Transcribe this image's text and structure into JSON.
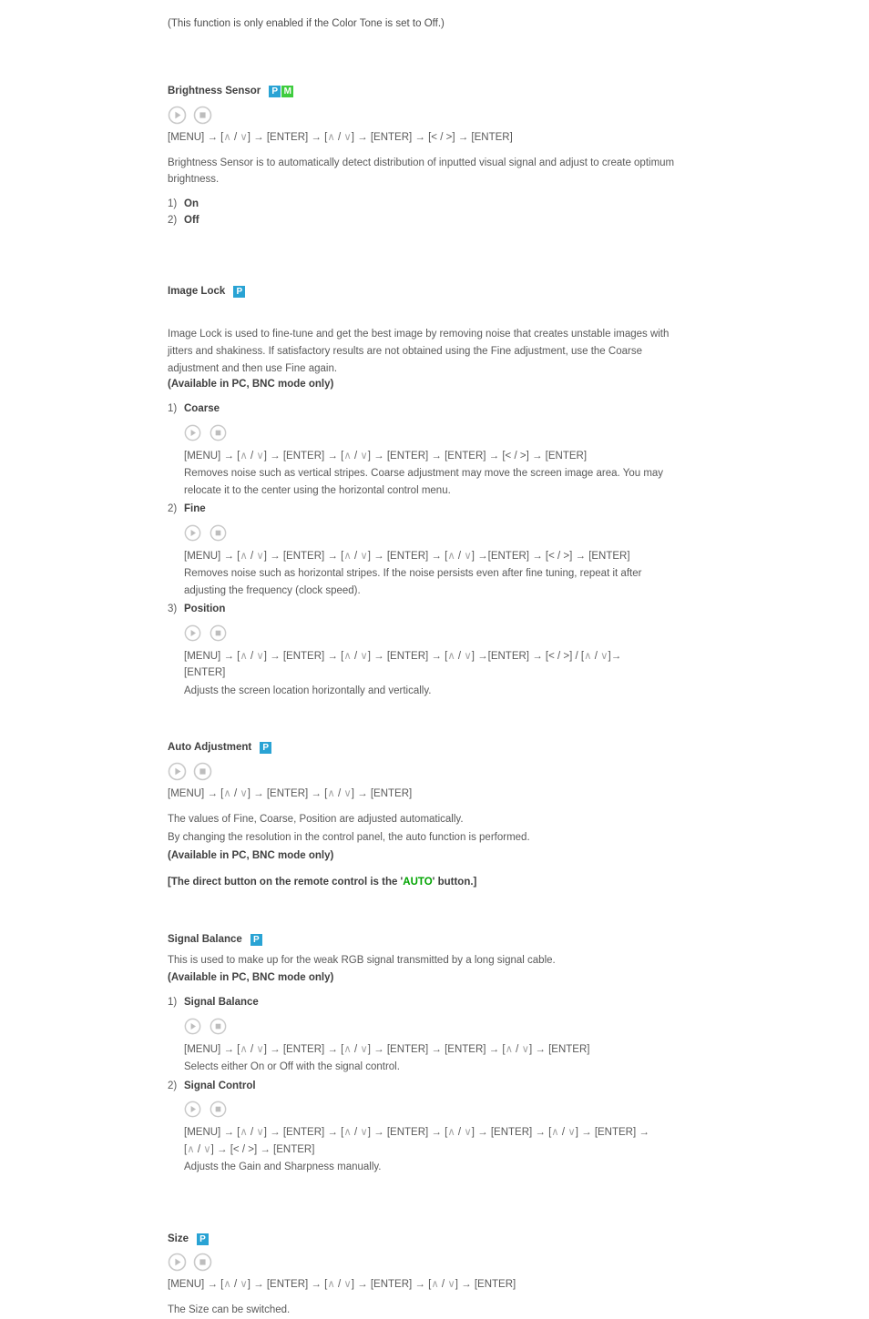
{
  "page": {
    "intro_note": "(This function is only enabled if the Color Tone is set to Off.)"
  },
  "colors": {
    "badge_p": "#29a3d4",
    "badge_m": "#3ecc3e",
    "auto_green": "#00a400",
    "text": "#595959",
    "heading": "#3f3f3f",
    "dim_arrow_key": "#a6a6a6"
  },
  "icons": {
    "play": "play-circle-icon",
    "stop": "stop-circle-icon",
    "badge_p": "pc-mode-badge-icon",
    "badge_m": "media-mode-badge-icon"
  },
  "badges": {
    "p_label": "P",
    "m_label": "M"
  },
  "sections": [
    {
      "id": "brightness-sensor",
      "title": "Brightness Sensor",
      "badges": [
        "P",
        "M"
      ],
      "menu_path": "[MENU] → [∧ / ∨] → [ENTER] → [∧ / ∨] → [ENTER] → [< / >] → [ENTER]",
      "description": "Brightness Sensor is to automatically detect distribution of inputted visual signal and adjust to create optimum brightness.",
      "items": [
        {
          "num": "1)",
          "label": "On"
        },
        {
          "num": "2)",
          "label": "Off"
        }
      ]
    },
    {
      "id": "image-lock",
      "title": "Image Lock",
      "badges": [
        "P"
      ],
      "description": "Image Lock is used to fine-tune and get the best image by removing noise that creates unstable images with jitters and shakiness. If satisfactory results are not obtained using the Fine adjustment, use the Coarse adjustment and then use Fine again.",
      "availability": "(Available in PC, BNC mode only)",
      "sub_items": [
        {
          "num": "1)",
          "label": "Coarse",
          "menu_path": "[MENU] → [∧ / ∨] → [ENTER] → [∧ / ∨] → [ENTER] → [ENTER] → [< / >] → [ENTER]",
          "description": "Removes noise such as vertical stripes. Coarse adjustment may move the screen image area. You may relocate it to the center using the horizontal control menu."
        },
        {
          "num": "2)",
          "label": "Fine",
          "menu_path": "[MENU] → [∧ / ∨] → [ENTER] → [∧ / ∨] → [ENTER] → [∧ / ∨] →[ENTER] → [< / >] → [ENTER]",
          "description": "Removes noise such as horizontal stripes. If the noise persists even after fine tuning, repeat it after adjusting the frequency (clock speed)."
        },
        {
          "num": "3)",
          "label": "Position",
          "menu_path": "[MENU] → [∧ / ∨] → [ENTER] → [∧ / ∨] → [ENTER] → [∧ / ∨] →[ENTER] → [< / >] / [∧ / ∨]→ [ENTER]",
          "description": "Adjusts the screen location horizontally and vertically."
        }
      ]
    },
    {
      "id": "auto-adjustment",
      "title": "Auto Adjustment",
      "badges": [
        "P"
      ],
      "menu_path": "[MENU] → [∧ / ∨] → [ENTER] → [∧ / ∨] → [ENTER]",
      "description_line1": "The values of Fine, Coarse, Position are adjusted automatically.",
      "description_line2": "By changing the resolution in the control panel, the auto function is performed.",
      "availability": "(Available in PC, BNC mode only)",
      "remote_note_prefix": "[The direct button on the remote control is the '",
      "remote_note_key": "AUTO",
      "remote_note_suffix": "' button.]"
    },
    {
      "id": "signal-balance",
      "title": "Signal Balance",
      "badges": [
        "P"
      ],
      "description": "This is used to make up for the weak RGB signal transmitted by a long signal cable.",
      "availability": "(Available in PC, BNC mode only)",
      "sub_items": [
        {
          "num": "1)",
          "label": "Signal Balance",
          "menu_path": "[MENU] → [∧ / ∨] → [ENTER] → [∧ / ∨] → [ENTER] → [ENTER] → [∧ / ∨] → [ENTER]",
          "description": "Selects either On or Off with the signal control."
        },
        {
          "num": "2)",
          "label": "Signal Control",
          "menu_path": "[MENU] → [∧ / ∨] → [ENTER] → [∧ / ∨] → [ENTER] → [∧ / ∨] → [ENTER] → [∧ / ∨] → [ENTER] → [∧ / ∨] → [< / >] → [ENTER]",
          "description": "Adjusts the Gain and Sharpness manually."
        }
      ]
    },
    {
      "id": "size",
      "title": "Size",
      "badges": [
        "P"
      ],
      "menu_path": "[MENU] → [∧ / ∨] → [ENTER] → [∧ / ∨] → [ENTER] → [∧ / ∨] → [ENTER]",
      "description": "The Size can be switched."
    }
  ]
}
